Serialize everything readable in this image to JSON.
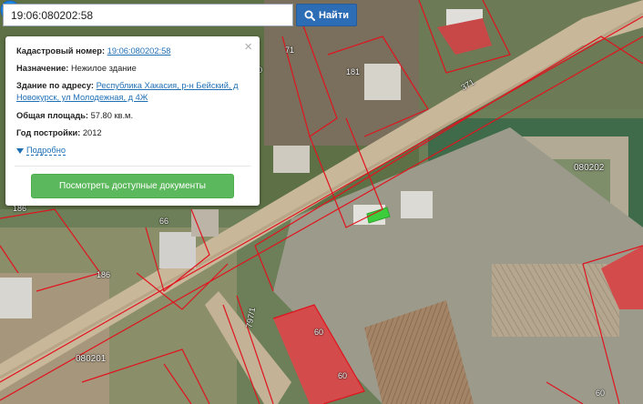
{
  "search": {
    "value": "19:06:080202:58",
    "button_label": "Найти"
  },
  "popup": {
    "cadastral_label": "Кадастровый номер:",
    "cadastral_value": "19:06:080202:58",
    "purpose_label": "Назначение:",
    "purpose_value": "Нежилое здание",
    "address_label": "Здание по адресу:",
    "address_line1": "Республика Хакасия, р-н Бейский, д",
    "address_line2": "Новокурск, ул Молодежная, д 4Ж",
    "area_label": "Общая площадь:",
    "area_value": "57.80 кв.м.",
    "year_label": "Год постройки:",
    "year_value": "2012",
    "more_label": "Подробно",
    "docs_button": "Посмотреть доступные документы",
    "close_glyph": "×"
  },
  "map": {
    "labels": {
      "p371": "371",
      "p71": "71",
      "p181": "181",
      "p080202": "080202",
      "p186a": "186",
      "p66": "66",
      "p186b": "186",
      "p080201": "080201",
      "p7971": "797/1",
      "p60a": "60",
      "p60b": "60",
      "p60c": "60",
      "p0": "0"
    },
    "parcel_color": "#e0141e",
    "selected_color": "#3ccd3c",
    "pin_color": "#1e88e5"
  }
}
